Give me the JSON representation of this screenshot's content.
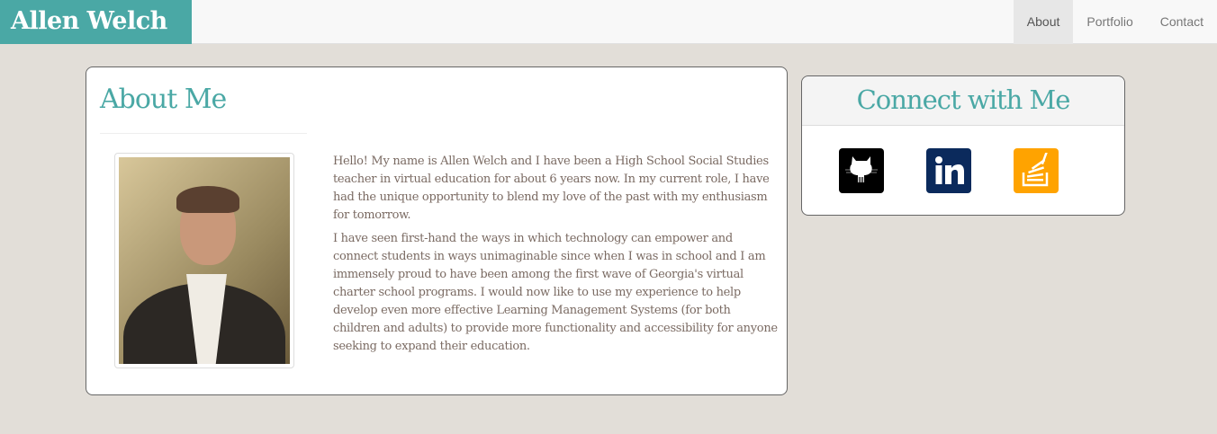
{
  "nav": {
    "brand": "Allen Welch",
    "links": [
      {
        "label": "About",
        "active": true
      },
      {
        "label": "Portfolio"
      },
      {
        "label": "Contact"
      }
    ]
  },
  "about": {
    "title": "About Me",
    "paragraphs": [
      "Hello! My name is Allen Welch and I have been a High School Social Studies teacher in virtual education for about 6 years now. In my current role, I have had the unique opportunity to blend my love of the past with my enthusiasm for tomorrow.",
      "I have seen first-hand the ways in which technology can empower and connect students in ways unimaginable since when I was in school and I am immensely proud to have been among the first wave of Georgia's virtual charter school programs. I would now like to use my experience to help develop even more effective Learning Management Systems (for both children and adults) to provide more functionality and accessibility for anyone seeking to expand their education."
    ]
  },
  "connect": {
    "title": "Connect with Me",
    "icons": [
      "github-icon",
      "linkedin-icon",
      "stackoverflow-icon"
    ]
  },
  "colors": {
    "accent": "#4aa8a5",
    "github": "#000000",
    "linkedin": "#0b2a5c",
    "stackoverflow": "#ffa300"
  }
}
